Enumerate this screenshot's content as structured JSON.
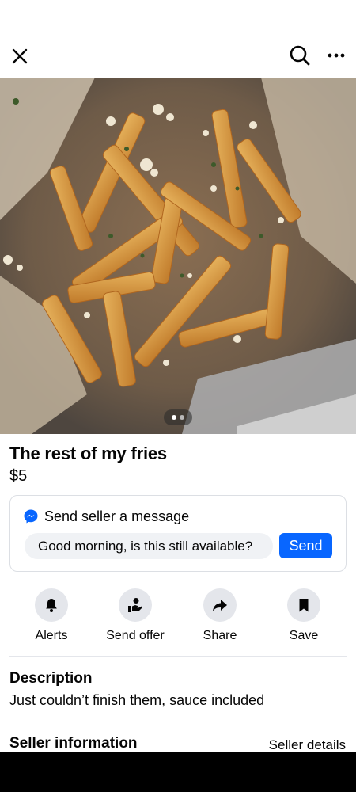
{
  "header": {
    "close_icon": "close-icon",
    "search_icon": "search-icon",
    "more_icon": "more-horizontal-icon"
  },
  "listing": {
    "title": "The rest of my fries",
    "price": "$5",
    "photo_count": 2,
    "current_photo": 1
  },
  "message": {
    "label": "Send seller a message",
    "input_value": "Good morning, is this still available?",
    "send_label": "Send",
    "icon": "messenger-icon"
  },
  "actions": [
    {
      "label": "Alerts",
      "icon": "bell-icon"
    },
    {
      "label": "Send offer",
      "icon": "offer-hand-icon"
    },
    {
      "label": "Share",
      "icon": "share-arrow-icon"
    },
    {
      "label": "Save",
      "icon": "bookmark-icon"
    }
  ],
  "description": {
    "heading": "Description",
    "text": "Just couldn’t finish them, sauce included"
  },
  "seller": {
    "heading": "Seller information",
    "details_link": "Seller details"
  },
  "colors": {
    "accent": "#0866ff",
    "action_circle": "#e4e6eb",
    "input_bg": "#f0f2f5"
  }
}
